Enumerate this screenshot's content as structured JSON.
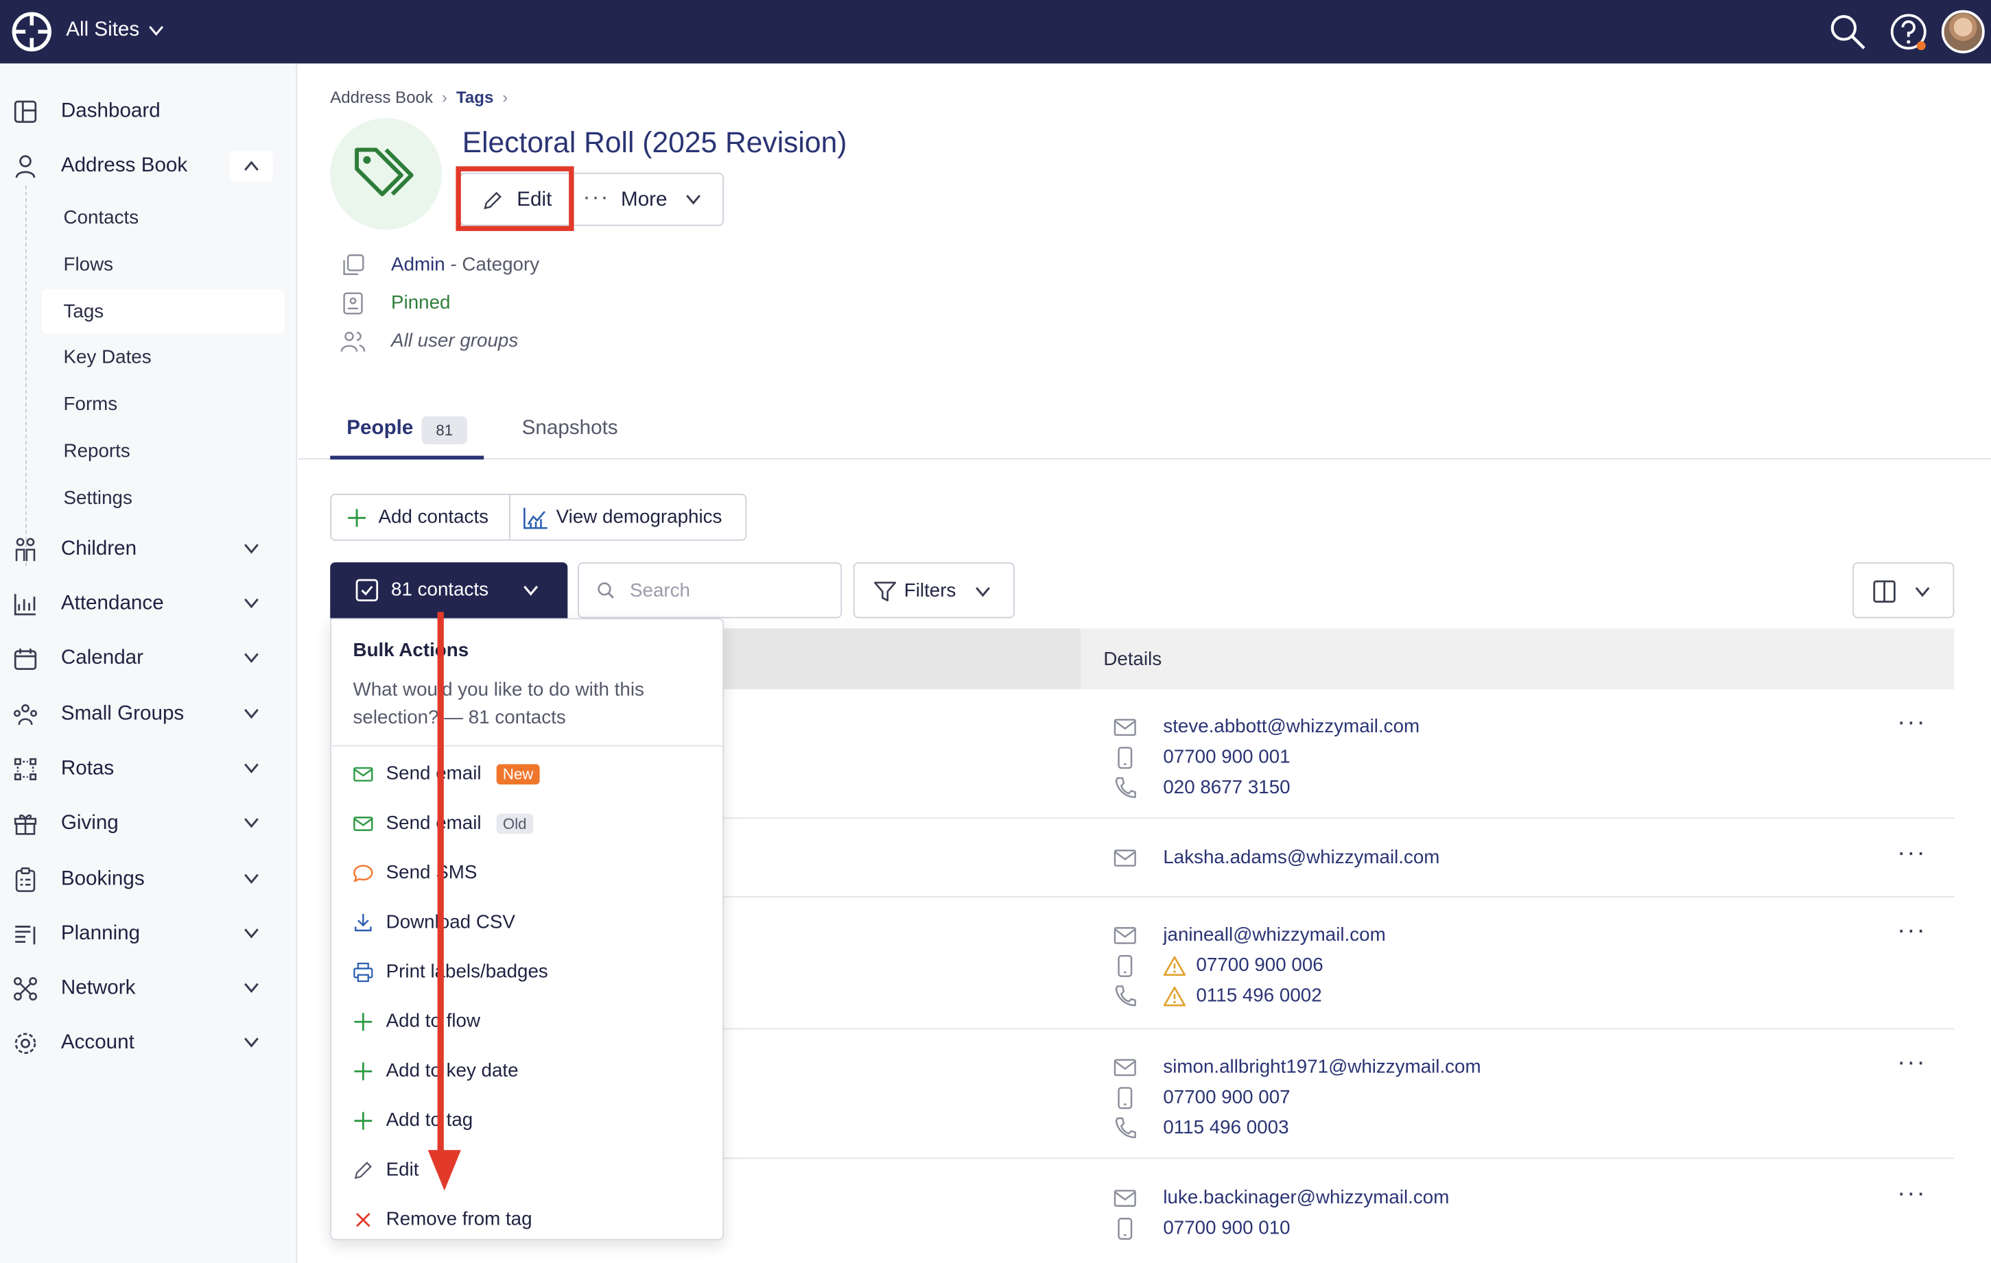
{
  "topbar": {
    "site_label": "All Sites"
  },
  "sidebar": {
    "items": [
      {
        "label": "Dashboard",
        "icon": "dashboard-icon"
      },
      {
        "label": "Address Book",
        "icon": "person-icon"
      },
      {
        "label": "Children",
        "icon": "children-icon"
      },
      {
        "label": "Attendance",
        "icon": "chart-icon"
      },
      {
        "label": "Calendar",
        "icon": "calendar-icon"
      },
      {
        "label": "Small Groups",
        "icon": "groups-icon"
      },
      {
        "label": "Rotas",
        "icon": "rotas-icon"
      },
      {
        "label": "Giving",
        "icon": "gift-icon"
      },
      {
        "label": "Bookings",
        "icon": "clipboard-icon"
      },
      {
        "label": "Planning",
        "icon": "planning-icon"
      },
      {
        "label": "Network",
        "icon": "network-icon"
      },
      {
        "label": "Account",
        "icon": "gear-icon"
      }
    ],
    "subitems": [
      "Contacts",
      "Flows",
      "Tags",
      "Key Dates",
      "Forms",
      "Reports",
      "Settings"
    ],
    "active_subitem": "Tags"
  },
  "breadcrumb": {
    "parent": "Address Book",
    "current": "Tags"
  },
  "page": {
    "title": "Electoral Roll (2025 Revision)",
    "edit_label": "Edit",
    "more_label": "More",
    "category_owner": "Admin",
    "category_suffix": " - Category",
    "pinned": "Pinned",
    "visibility": "All user groups"
  },
  "tabs": {
    "people_label": "People",
    "people_count": "81",
    "snapshots_label": "Snapshots"
  },
  "actions": {
    "add_contacts": "Add contacts",
    "view_demographics": "View demographics"
  },
  "toolbar": {
    "selection_label": "81 contacts",
    "search_placeholder": "Search",
    "filters_label": "Filters"
  },
  "table": {
    "details_header": "Details",
    "rows": [
      {
        "email": "steve.abbott@whizzymail.com",
        "mobile": "07700 900 001",
        "phone": "020 8677 3150"
      },
      {
        "email": "Laksha.adams@whizzymail.com"
      },
      {
        "email": "janineall@whizzymail.com",
        "mobile": "07700 900 006",
        "phone": "0115 496 0002"
      },
      {
        "email": "simon.allbright1971@whizzymail.com",
        "mobile": "07700 900 007",
        "phone": "0115 496 0003"
      },
      {
        "email": "luke.backinager@whizzymail.com",
        "mobile": "07700 900 010"
      }
    ]
  },
  "bulk_actions": {
    "title": "Bulk Actions",
    "description": "What would you like to do with this selection? — 81 contacts",
    "items": [
      {
        "label": "Send email",
        "badge": "New"
      },
      {
        "label": "Send email",
        "badge": "Old"
      },
      {
        "label": "Send SMS"
      },
      {
        "label": "Download CSV"
      },
      {
        "label": "Print labels/badges"
      },
      {
        "label": "Add to flow"
      },
      {
        "label": "Add to key date"
      },
      {
        "label": "Add to tag"
      },
      {
        "label": "Edit"
      },
      {
        "label": "Remove from tag"
      }
    ]
  },
  "colors": {
    "navy": "#22264f",
    "link": "#2a3474",
    "green": "#2e7d3a",
    "orange": "#f0762c",
    "red": "#e23a2a"
  }
}
